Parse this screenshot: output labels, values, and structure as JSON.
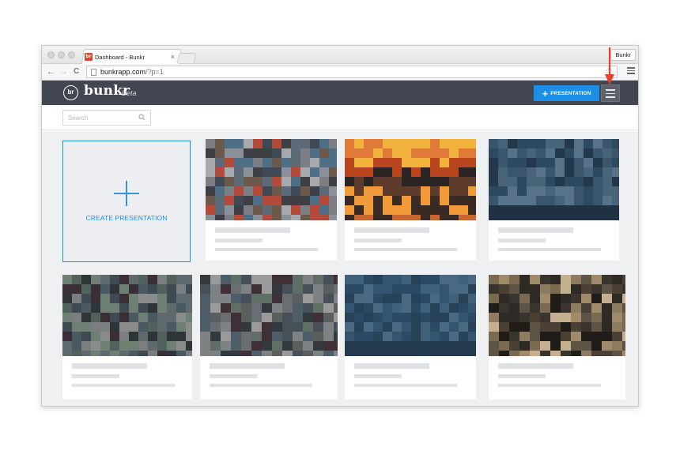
{
  "browser": {
    "tab_title": "Dashboard - Bunkr",
    "tab_favicon_text": "br",
    "tab_close": "×",
    "profile_name": "Bunkr",
    "url_host": "bunkrapp.com",
    "url_path": "/?p=1",
    "back_icon": "←",
    "forward_icon": "→",
    "reload_icon": "C",
    "star_icon": "☆"
  },
  "app": {
    "logo_badge": "br",
    "logo_word": "bunkr",
    "logo_beta": "Beta",
    "new_presentation_plus": "+",
    "new_presentation_label": "PRESENTATION"
  },
  "search": {
    "placeholder": "Search"
  },
  "create_card": {
    "label": "CREATE PRESENTATION"
  },
  "colors": {
    "accent": "#1b8ee6",
    "header_bg": "#414650",
    "annotation": "#e8412a"
  },
  "presentations": [
    {
      "thumb_palette": [
        "#7b7e84",
        "#5d6a78",
        "#3f4a56",
        "#8a9099",
        "#6b5a4c",
        "#b44a3a",
        "#4f6f87",
        "#a7a9ad",
        "#3e3f44"
      ]
    },
    {
      "thumb_palette": [
        "#e07a38",
        "#f2b33e",
        "#b8451e",
        "#2b2422",
        "#5e3c2c",
        "#f19a3a",
        "#3a2a24",
        "#c9652c",
        "#8c4a2a"
      ]
    },
    {
      "thumb_palette": [
        "#3b566c",
        "#2e4a60",
        "#486479",
        "#23394b",
        "#58728a",
        "#36556e",
        "#1f3142",
        "#6c8192",
        "#2a4356"
      ]
    },
    {
      "thumb_palette": [
        "#5f6a6e",
        "#3f4a52",
        "#7b7e80",
        "#2e3438",
        "#6e7f74",
        "#4a5a62",
        "#8a8c8c",
        "#3c2e36",
        "#51625c"
      ]
    },
    {
      "thumb_palette": [
        "#6a6e72",
        "#475058",
        "#7f8284",
        "#323a40",
        "#5f6f66",
        "#4e5e68",
        "#9a9a9a",
        "#3f3038",
        "#585f5c"
      ]
    },
    {
      "thumb_palette": [
        "#355470",
        "#2c4a64",
        "#41607a",
        "#284258",
        "#4b6a82",
        "#30506a",
        "#233a4e",
        "#8a98a4",
        "#395a74"
      ]
    },
    {
      "thumb_palette": [
        "#7a6a52",
        "#4a4034",
        "#a08a6a",
        "#2e2a26",
        "#c4b090",
        "#5e5446",
        "#3a342e",
        "#8e7c62",
        "#201c18"
      ]
    }
  ]
}
